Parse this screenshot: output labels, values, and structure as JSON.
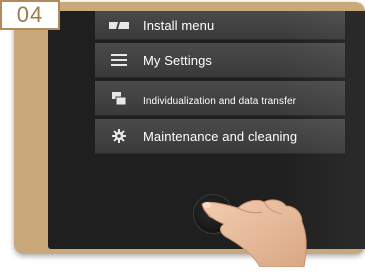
{
  "step": {
    "number": "04"
  },
  "menu": {
    "items": [
      {
        "icon": "install-menu-icon",
        "label": "Install menu",
        "size": "normal"
      },
      {
        "icon": "hamburger-menu-icon",
        "label": "My Settings",
        "size": "normal"
      },
      {
        "icon": "data-transfer-icon",
        "label": "Individualization and data transfer",
        "size": "small"
      },
      {
        "icon": "gear-icon",
        "label": "Maintenance and cleaning",
        "size": "normal"
      }
    ]
  },
  "power": {
    "icon": "power-icon"
  },
  "colors": {
    "frame": "#c9a87a",
    "screen": "#1f1f1f",
    "menu_item": "#444444",
    "badge_border": "#b38a5a"
  }
}
